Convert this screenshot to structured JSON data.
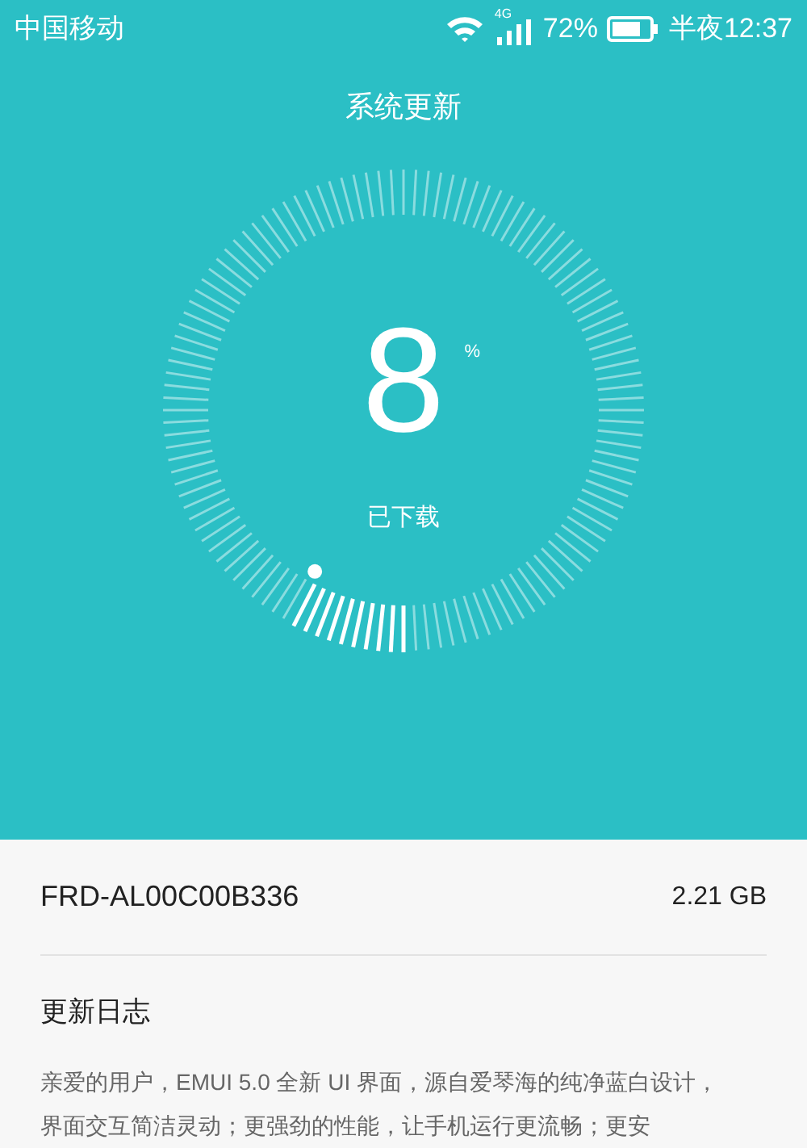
{
  "status_bar": {
    "carrier": "中国移动",
    "network": "4G",
    "battery": "72%",
    "time": "半夜12:37"
  },
  "title": "系统更新",
  "progress": {
    "value": "8",
    "unit": "%",
    "label": "已下载"
  },
  "package": {
    "name": "FRD-AL00C00B336",
    "size": "2.21 GB"
  },
  "changelog": {
    "heading": "更新日志",
    "text": "亲爱的用户，EMUI 5.0 全新 UI 界面，源自爱琴海的纯净蓝白设计，界面交互简洁灵动；更强劲的性能，让手机运行更流畅；更安"
  }
}
